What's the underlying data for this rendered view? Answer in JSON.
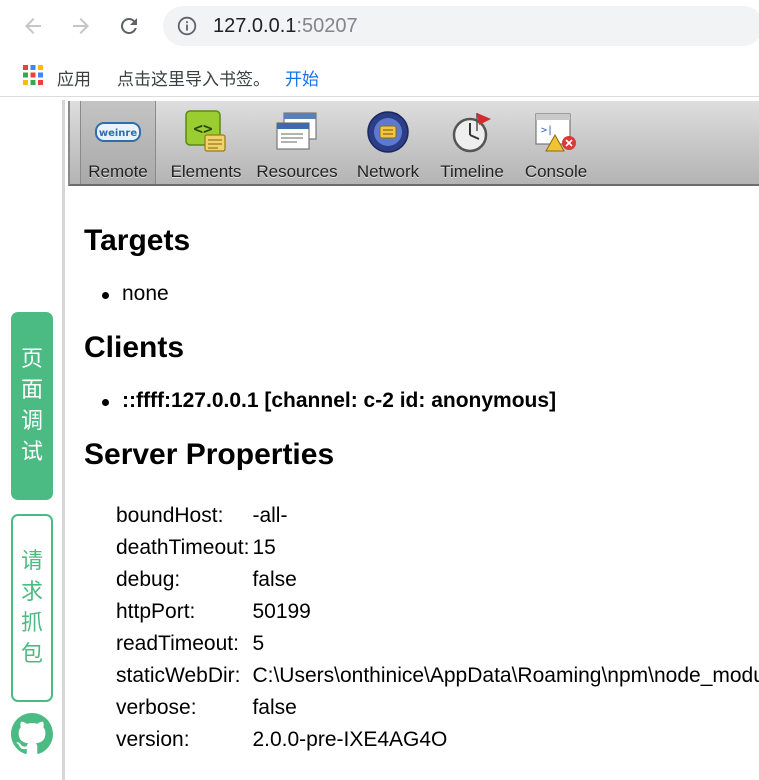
{
  "browser": {
    "url_host": "127.0.0.1",
    "url_port": ":50207",
    "bookmarks": {
      "apps_label": "应用",
      "import_text": "点击这里导入书签。",
      "start_link": "开始"
    }
  },
  "sidebar": {
    "primary_button": [
      "页",
      "面",
      "调",
      "试"
    ],
    "secondary_button": [
      "请",
      "求",
      "抓",
      "包"
    ],
    "accent_color": "#4cbb83"
  },
  "toolbar": {
    "items": [
      {
        "label": "Remote",
        "icon": "weinre-logo-icon",
        "selected": true
      },
      {
        "label": "Elements",
        "icon": "elements-icon"
      },
      {
        "label": "Resources",
        "icon": "resources-icon"
      },
      {
        "label": "Network",
        "icon": "network-icon"
      },
      {
        "label": "Timeline",
        "icon": "timeline-icon"
      },
      {
        "label": "Console",
        "icon": "console-icon"
      }
    ]
  },
  "content": {
    "targets_heading": "Targets",
    "targets": [
      "none"
    ],
    "clients_heading": "Clients",
    "clients": [
      "::ffff:127.0.0.1 [channel: c-2 id: anonymous]"
    ],
    "server_heading": "Server Properties",
    "properties": [
      {
        "key": "boundHost:",
        "value": "-all-"
      },
      {
        "key": "deathTimeout:",
        "value": "15"
      },
      {
        "key": "debug:",
        "value": "false"
      },
      {
        "key": "httpPort:",
        "value": "50199"
      },
      {
        "key": "readTimeout:",
        "value": "5"
      },
      {
        "key": "staticWebDir:",
        "value": "C:\\Users\\onthinice\\AppData\\Roaming\\npm\\node_modules\\weinre\\web"
      },
      {
        "key": "verbose:",
        "value": "false"
      },
      {
        "key": "version:",
        "value": "2.0.0-pre-IXE4AG4O"
      }
    ]
  }
}
